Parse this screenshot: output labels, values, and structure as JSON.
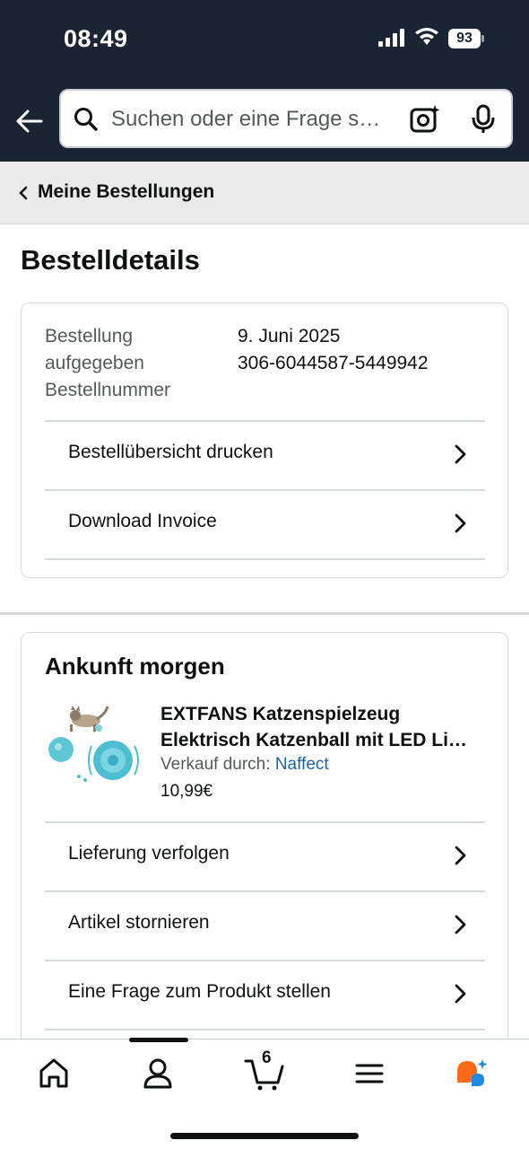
{
  "status_bar": {
    "time": "08:49",
    "battery": "93"
  },
  "header": {
    "search_placeholder": "Suchen oder eine Frage s…"
  },
  "breadcrumb": {
    "label": "Meine Bestellungen"
  },
  "page": {
    "title": "Bestelldetails"
  },
  "order_info": {
    "labels": [
      "Bestellung",
      "aufgegeben",
      "Bestellnummer"
    ],
    "date": "9. Juni 2025",
    "order_number": "306-6044587-5449942"
  },
  "order_actions": [
    {
      "label": "Bestellübersicht drucken"
    },
    {
      "label": "Download Invoice"
    }
  ],
  "shipment": {
    "heading": "Ankunft morgen",
    "product": {
      "title_line1": "EXTFANS Katzenspielzeug",
      "title_line2": "Elektrisch Katzenball mit LED Li…",
      "seller_prefix": "Verkauf durch:",
      "seller_name": "Naffect",
      "price": "10,99€"
    },
    "actions": [
      {
        "label": "Lieferung verfolgen"
      },
      {
        "label": "Artikel stornieren"
      },
      {
        "label": "Eine Frage zum Produkt stellen"
      }
    ]
  },
  "bottom_nav": {
    "cart_count": "6",
    "accent_color": "#ff6a1a",
    "rufus_color": "#1e88e5"
  }
}
